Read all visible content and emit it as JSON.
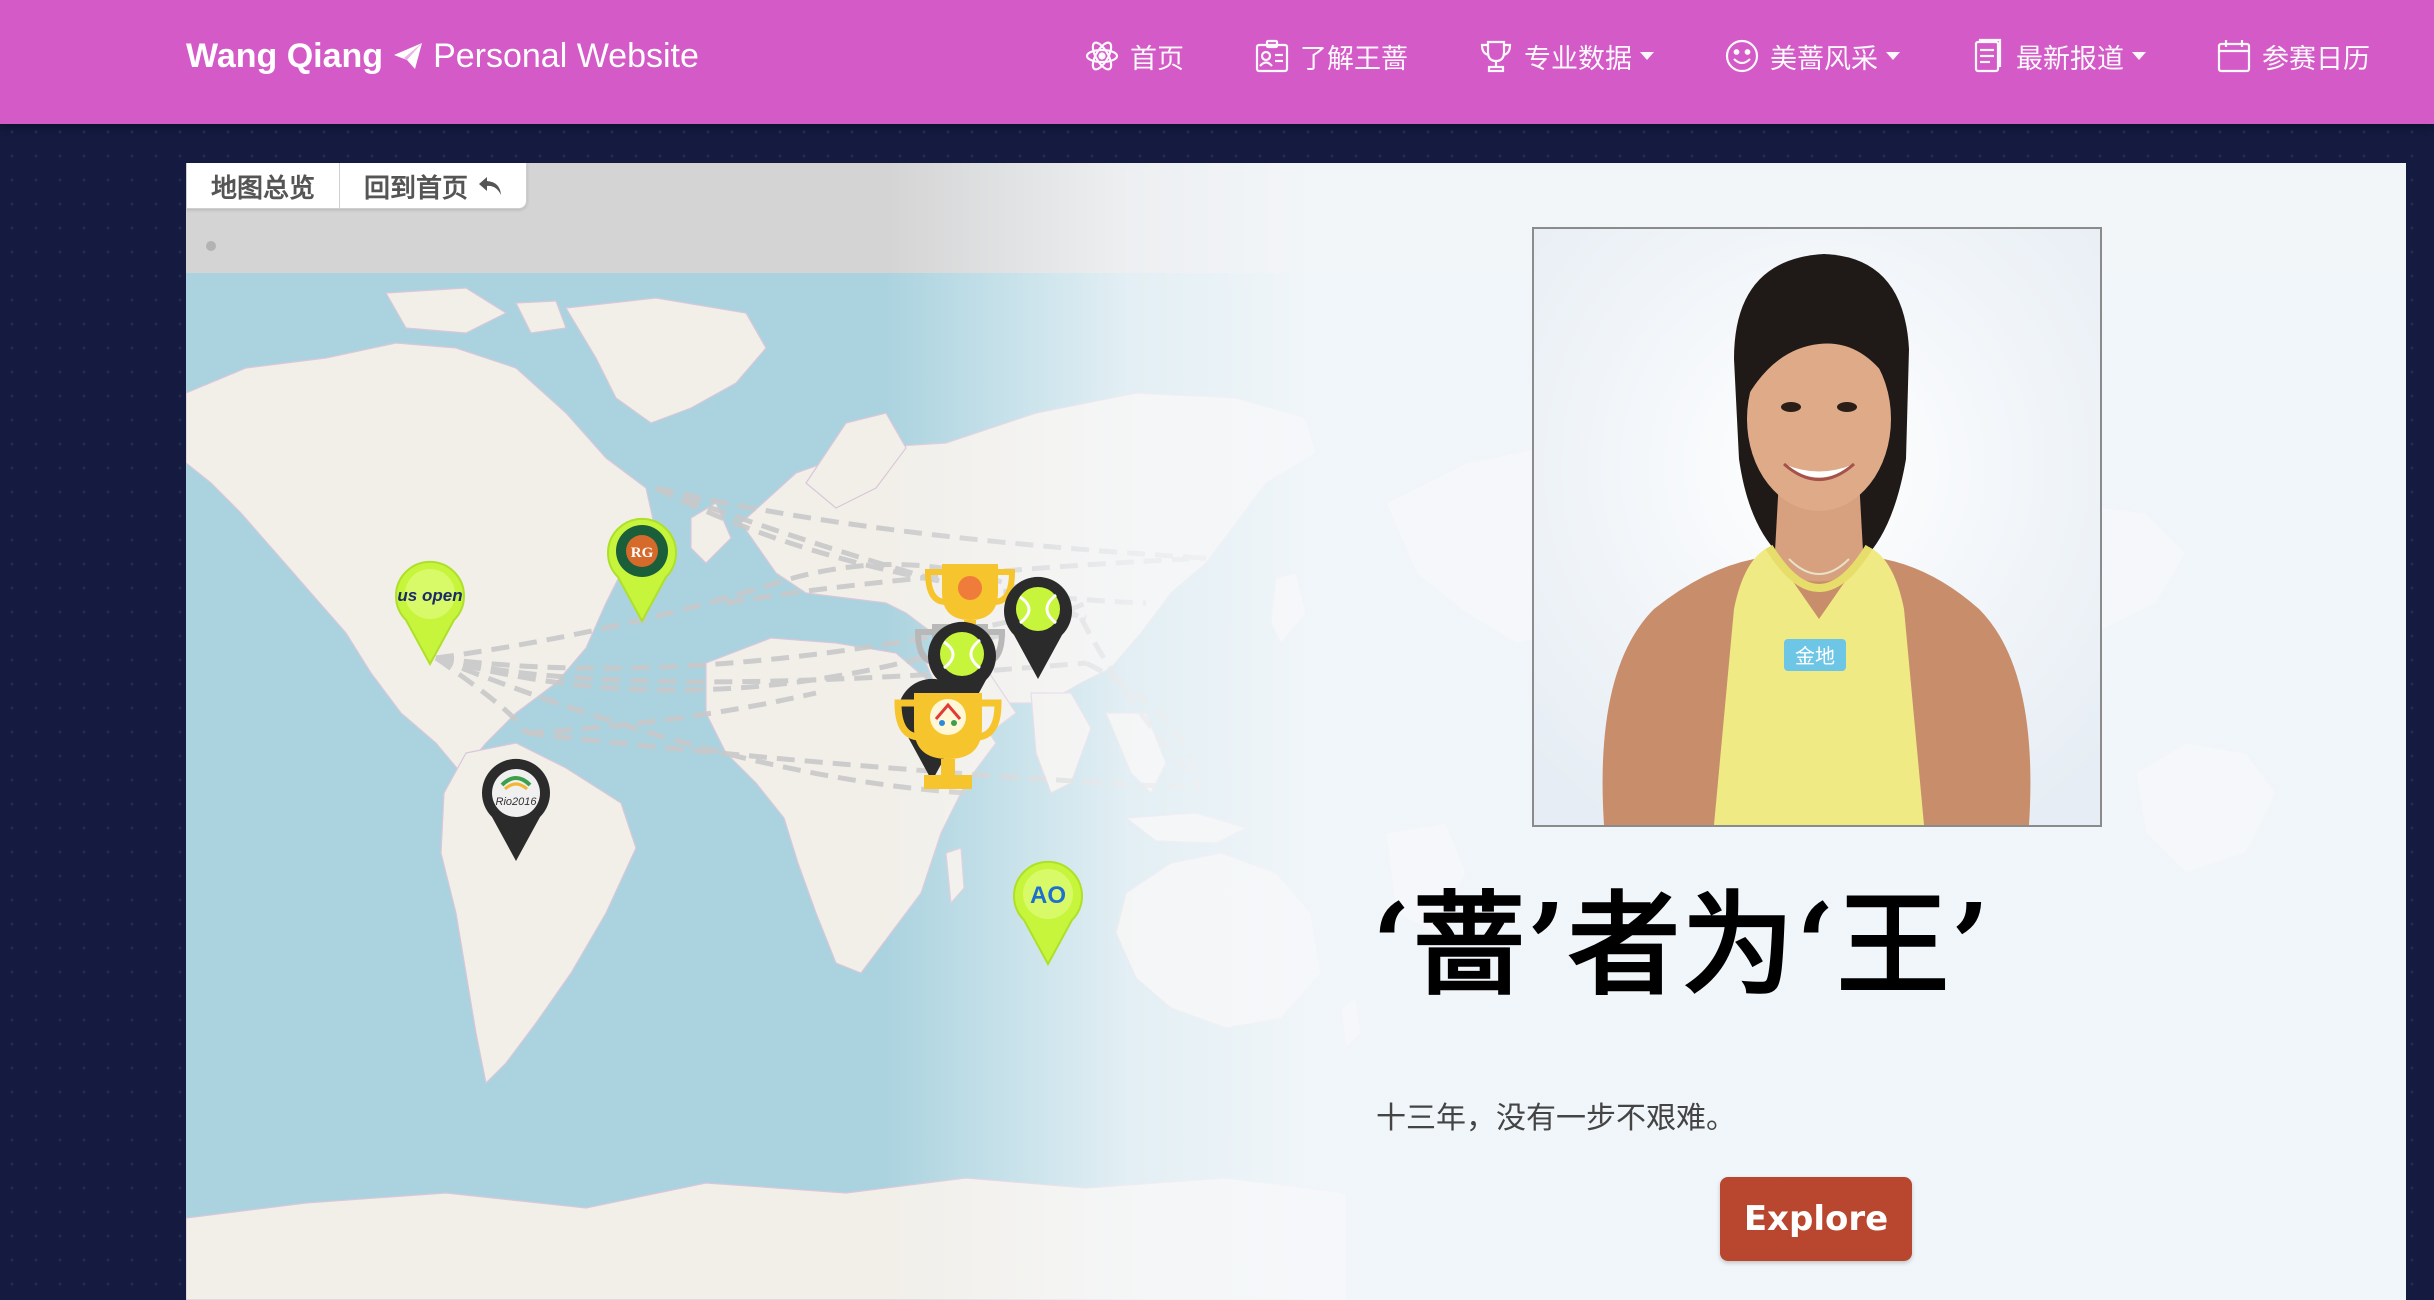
{
  "brand": {
    "name": "Wang Qiang",
    "subtitle": "Personal Website",
    "icon": "paper-plane-icon"
  },
  "nav": {
    "items": [
      {
        "label": "首页",
        "icon": "atom-icon",
        "dropdown": false
      },
      {
        "label": "了解王蔷",
        "icon": "id-card-icon",
        "dropdown": false
      },
      {
        "label": "专业数据",
        "icon": "trophy-icon",
        "dropdown": true
      },
      {
        "label": "美蔷风采",
        "icon": "smile-icon",
        "dropdown": true
      },
      {
        "label": "最新报道",
        "icon": "document-icon",
        "dropdown": true
      },
      {
        "label": "参赛日历",
        "icon": "calendar-icon",
        "dropdown": false
      }
    ]
  },
  "map": {
    "tabs": [
      {
        "label": "地图总览"
      },
      {
        "label": "回到首页",
        "icon": "reply-arrow-icon"
      }
    ],
    "markers": [
      {
        "name": "US Open",
        "label": "us open",
        "color": "#c7f53b"
      },
      {
        "name": "Roland Garros",
        "label": "RG",
        "color": "#c7f53b"
      },
      {
        "name": "Rio 2016",
        "label": "Rio2016",
        "color": "#2b2b2b"
      },
      {
        "name": "Australian Open",
        "label": "AO",
        "color": "#c7f53b"
      },
      {
        "name": "Asian Games Jakarta Palembang 2018",
        "label": "Asian Games",
        "color": "#f6c52e"
      },
      {
        "name": "Tennis tournament (East Asia)",
        "label": "tennis-ball",
        "color": "#2b2b2b"
      },
      {
        "name": "Tennis tournament (China)",
        "label": "tennis-ball",
        "color": "#2b2b2b"
      }
    ],
    "colors": {
      "ocean": "#abd3df",
      "land": "#f2efe9",
      "route": "#c9c9c9",
      "accent": "#c7f53b"
    }
  },
  "hero": {
    "title": "‘蔷’者为‘王’",
    "subtitle": "十三年，没有一步不艰难。",
    "cta": "Explore",
    "cta_color": "#b94730",
    "badge_text": "金地"
  },
  "carousel": {
    "next_icon": "chevron-right-icon"
  }
}
